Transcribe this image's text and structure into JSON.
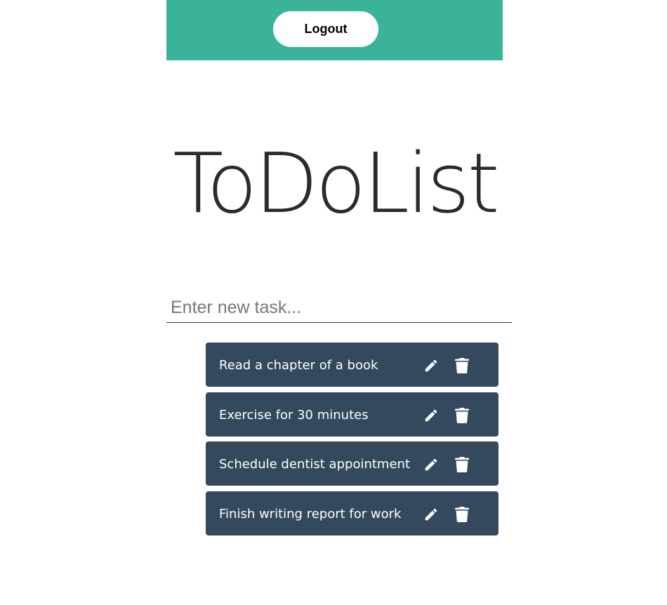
{
  "header": {
    "logout_label": "Logout"
  },
  "main": {
    "title": "ToDoList",
    "input": {
      "value": "",
      "placeholder": "Enter new task..."
    },
    "tasks": [
      {
        "text": "Read a chapter of a book"
      },
      {
        "text": "Exercise for 30 minutes"
      },
      {
        "text": "Schedule dentist appointment"
      },
      {
        "text": "Finish writing report for work"
      }
    ],
    "icons": {
      "edit": "pencil-icon",
      "delete": "trash-icon"
    }
  },
  "colors": {
    "header_bg": "#3bb39b",
    "task_bg": "#34495e",
    "task_text": "#ffffff",
    "title_text": "#2b2b2b"
  }
}
